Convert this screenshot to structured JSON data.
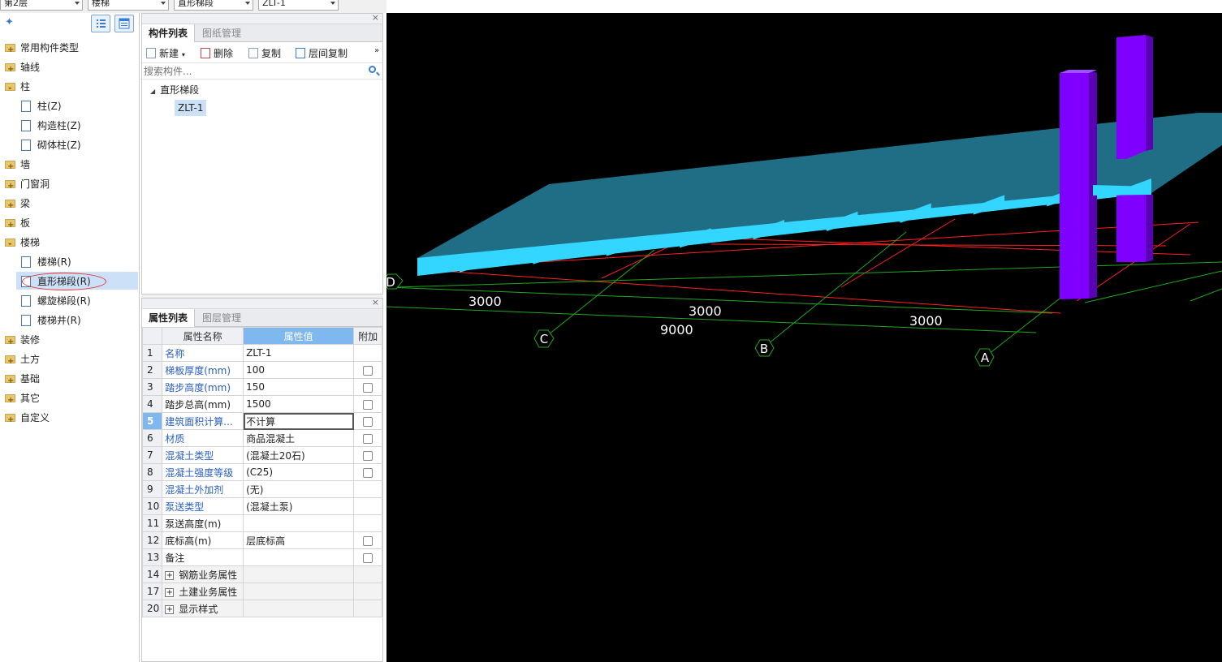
{
  "topbar": {
    "floor": "第2层",
    "category": "楼梯",
    "type": "直形梯段",
    "element": "ZLT-1"
  },
  "tree": {
    "items": [
      {
        "label": "常用构件类型",
        "kind": "folder",
        "state": "plus"
      },
      {
        "label": "轴线",
        "kind": "folder",
        "state": "plus"
      },
      {
        "label": "柱",
        "kind": "folder",
        "state": "minus"
      },
      {
        "label": "柱(Z)",
        "kind": "child",
        "icon": "column-icon"
      },
      {
        "label": "构造柱(Z)",
        "kind": "child",
        "icon": "constructional-column-icon"
      },
      {
        "label": "砌体柱(Z)",
        "kind": "child",
        "icon": "masonry-column-icon"
      },
      {
        "label": "墙",
        "kind": "folder",
        "state": "plus"
      },
      {
        "label": "门窗洞",
        "kind": "folder",
        "state": "plus"
      },
      {
        "label": "梁",
        "kind": "folder",
        "state": "plus"
      },
      {
        "label": "板",
        "kind": "folder",
        "state": "plus"
      },
      {
        "label": "楼梯",
        "kind": "folder",
        "state": "minus"
      },
      {
        "label": "楼梯(R)",
        "kind": "child",
        "icon": "stair-icon"
      },
      {
        "label": "直形梯段(R)",
        "kind": "child",
        "icon": "straight-flight-icon",
        "selected": true
      },
      {
        "label": "螺旋梯段(R)",
        "kind": "child",
        "icon": "spiral-flight-icon"
      },
      {
        "label": "楼梯井(R)",
        "kind": "child",
        "icon": "stairwell-icon"
      },
      {
        "label": "装修",
        "kind": "folder",
        "state": "plus"
      },
      {
        "label": "土方",
        "kind": "folder",
        "state": "plus"
      },
      {
        "label": "基础",
        "kind": "folder",
        "state": "plus"
      },
      {
        "label": "其它",
        "kind": "folder",
        "state": "plus"
      },
      {
        "label": "自定义",
        "kind": "folder",
        "state": "plus"
      }
    ]
  },
  "component_panel": {
    "tabs": [
      "构件列表",
      "图纸管理"
    ],
    "tools": {
      "new": "新建",
      "delete": "删除",
      "copy": "复制",
      "floor_copy": "层间复制"
    },
    "search_placeholder": "搜索构件...",
    "group": "直形梯段",
    "item": "ZLT-1"
  },
  "property_panel": {
    "tabs": [
      "属性列表",
      "图层管理"
    ],
    "headers": {
      "name": "属性名称",
      "value": "属性值",
      "extra": "附加"
    },
    "rows": [
      {
        "num": "1",
        "name": "名称",
        "value": "ZLT-1",
        "blue": true,
        "checkbox": false
      },
      {
        "num": "2",
        "name": "梯板厚度(mm)",
        "value": "100",
        "blue": true,
        "checkbox": true
      },
      {
        "num": "3",
        "name": "踏步高度(mm)",
        "value": "150",
        "blue": true,
        "checkbox": true
      },
      {
        "num": "4",
        "name": "踏步总高(mm)",
        "value": "1500",
        "blue": false,
        "checkbox": true
      },
      {
        "num": "5",
        "name": "建筑面积计算...",
        "value": "不计算",
        "blue": true,
        "checkbox": true,
        "highlight": true
      },
      {
        "num": "6",
        "name": "材质",
        "value": "商品混凝土",
        "blue": true,
        "checkbox": true
      },
      {
        "num": "7",
        "name": "混凝土类型",
        "value": "(混凝土20石)",
        "blue": true,
        "checkbox": true
      },
      {
        "num": "8",
        "name": "混凝土强度等级",
        "value": "(C25)",
        "blue": true,
        "checkbox": true
      },
      {
        "num": "9",
        "name": "混凝土外加剂",
        "value": "(无)",
        "blue": true,
        "checkbox": false
      },
      {
        "num": "10",
        "name": "泵送类型",
        "value": "(混凝土泵)",
        "blue": true,
        "checkbox": false
      },
      {
        "num": "11",
        "name": "泵送高度(m)",
        "value": "",
        "blue": false,
        "checkbox": false
      },
      {
        "num": "12",
        "name": "底标高(m)",
        "value": "层底标高",
        "blue": false,
        "checkbox": true
      },
      {
        "num": "13",
        "name": "备注",
        "value": "",
        "blue": false,
        "checkbox": true
      },
      {
        "num": "14",
        "name": "钢筋业务属性",
        "value": "",
        "group": true
      },
      {
        "num": "17",
        "name": "土建业务属性",
        "value": "",
        "group": true
      },
      {
        "num": "20",
        "name": "显示样式",
        "value": "",
        "group": true
      }
    ]
  },
  "viewport": {
    "axis_labels": [
      "D",
      "C",
      "B",
      "A"
    ],
    "dimensions": [
      "3000",
      "3000",
      "3000",
      "9000"
    ],
    "colors": {
      "background": "#000000",
      "stair_top": "#1f6e86",
      "stair_front": "#33d6ff",
      "column": "#8000ff",
      "grid_red": "#ff2020",
      "grid_green": "#1fa81f"
    }
  }
}
